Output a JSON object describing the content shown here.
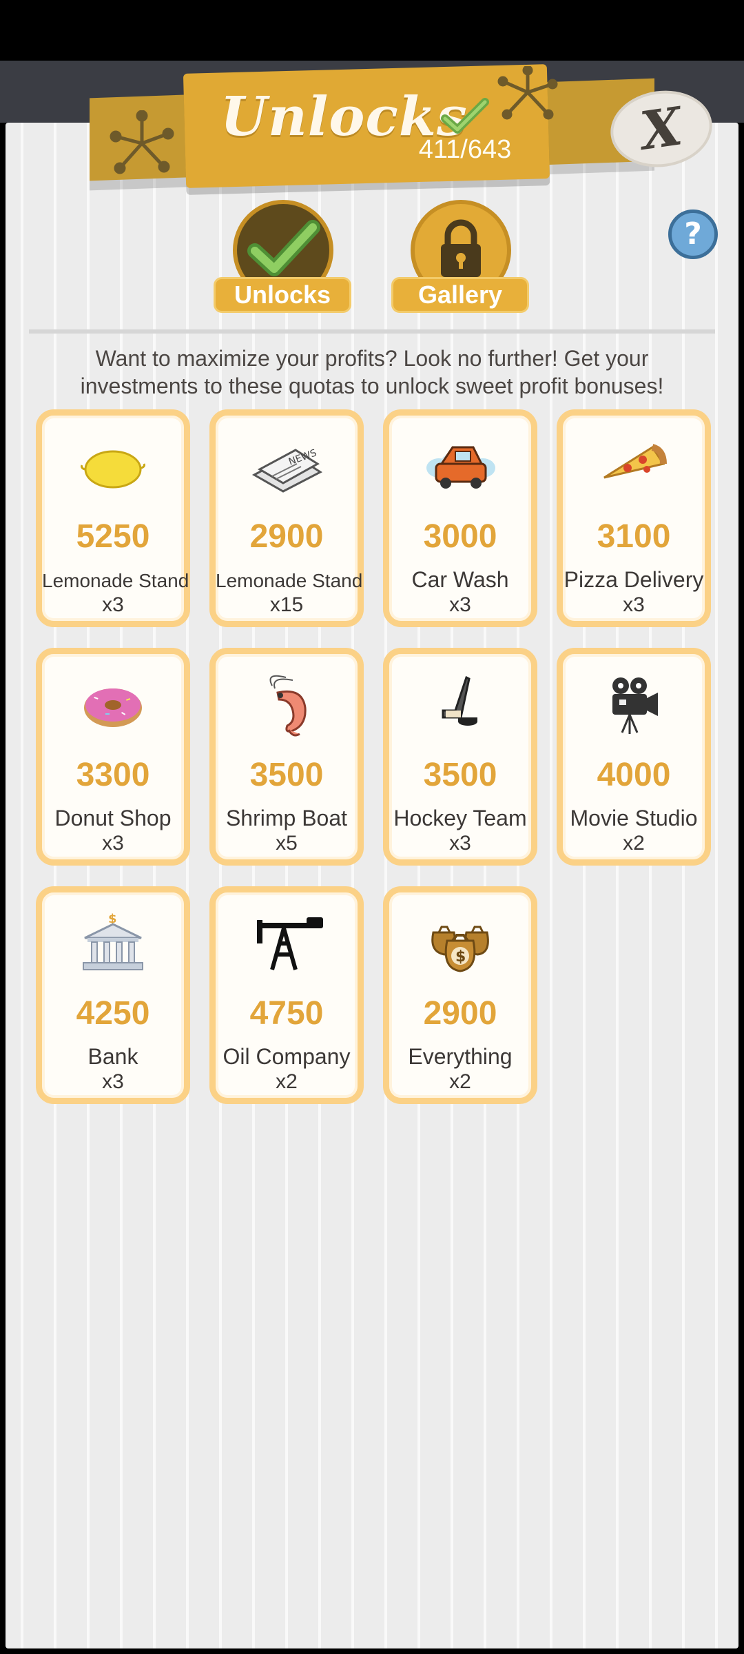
{
  "header": {
    "title": "Unlocks",
    "progress_text": "411/643"
  },
  "tabs": [
    {
      "label": "Unlocks",
      "icon": "check-icon",
      "active": true
    },
    {
      "label": "Gallery",
      "icon": "lock-icon",
      "active": false
    }
  ],
  "help_label": "?",
  "close_label": "X",
  "intro": {
    "line1": "Want to maximize your profits? Look no further! Get your",
    "line2": "investments to these quotas to unlock sweet profit bonuses!"
  },
  "unlocks": [
    {
      "quota": "5250",
      "name": "Lemonade Stand",
      "mult": "x3",
      "icon": "lemon-icon"
    },
    {
      "quota": "2900",
      "name": "Lemonade Stand",
      "mult": "x15",
      "icon": "newspaper-icon"
    },
    {
      "quota": "3000",
      "name": "Car Wash",
      "mult": "x3",
      "icon": "car-icon"
    },
    {
      "quota": "3100",
      "name": "Pizza Delivery",
      "mult": "x3",
      "icon": "pizza-icon"
    },
    {
      "quota": "3300",
      "name": "Donut Shop",
      "mult": "x3",
      "icon": "donut-icon"
    },
    {
      "quota": "3500",
      "name": "Shrimp Boat",
      "mult": "x5",
      "icon": "shrimp-icon"
    },
    {
      "quota": "3500",
      "name": "Hockey Team",
      "mult": "x3",
      "icon": "hockey-stick-icon"
    },
    {
      "quota": "4000",
      "name": "Movie Studio",
      "mult": "x2",
      "icon": "movie-camera-icon"
    },
    {
      "quota": "4250",
      "name": "Bank",
      "mult": "x3",
      "icon": "bank-icon"
    },
    {
      "quota": "4750",
      "name": "Oil Company",
      "mult": "x2",
      "icon": "oil-rig-icon"
    },
    {
      "quota": "2900",
      "name": "Everything",
      "mult": "x2",
      "icon": "money-bags-icon"
    }
  ],
  "colors": {
    "accent": "#e0a934",
    "quota_text": "#e2a53a",
    "card_border": "#fbd186",
    "help_blue": "#6fa9d8"
  }
}
